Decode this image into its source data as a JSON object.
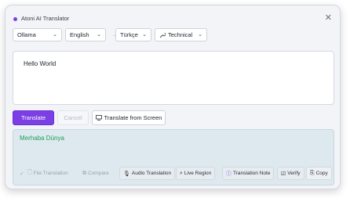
{
  "window": {
    "title": "Atoni AI Translator",
    "close": "✕"
  },
  "selectors": {
    "engine": "Ollama",
    "source_lang": "English",
    "arrow": "→",
    "target_lang": "Türkçe",
    "mode": "Technical",
    "chevron": "⌄"
  },
  "input": {
    "text": "Hello World"
  },
  "buttons": {
    "translate": "Translate",
    "cancel": "Cancel",
    "translate_screen": "Translate from Screen"
  },
  "output": {
    "text": "Merhaba Dünya"
  },
  "toolbar": {
    "check": "✓",
    "file_translation": "File Translation",
    "compare": "Compare",
    "audio_translation": "Audio Translation",
    "live_region": "Live Region",
    "translation_note": "Translation Note",
    "verify": "Verify",
    "copy": "Copy"
  },
  "colors": {
    "accent": "#7b3fe4",
    "output_text": "#1f9e5b",
    "output_bg": "#dde9ee"
  }
}
